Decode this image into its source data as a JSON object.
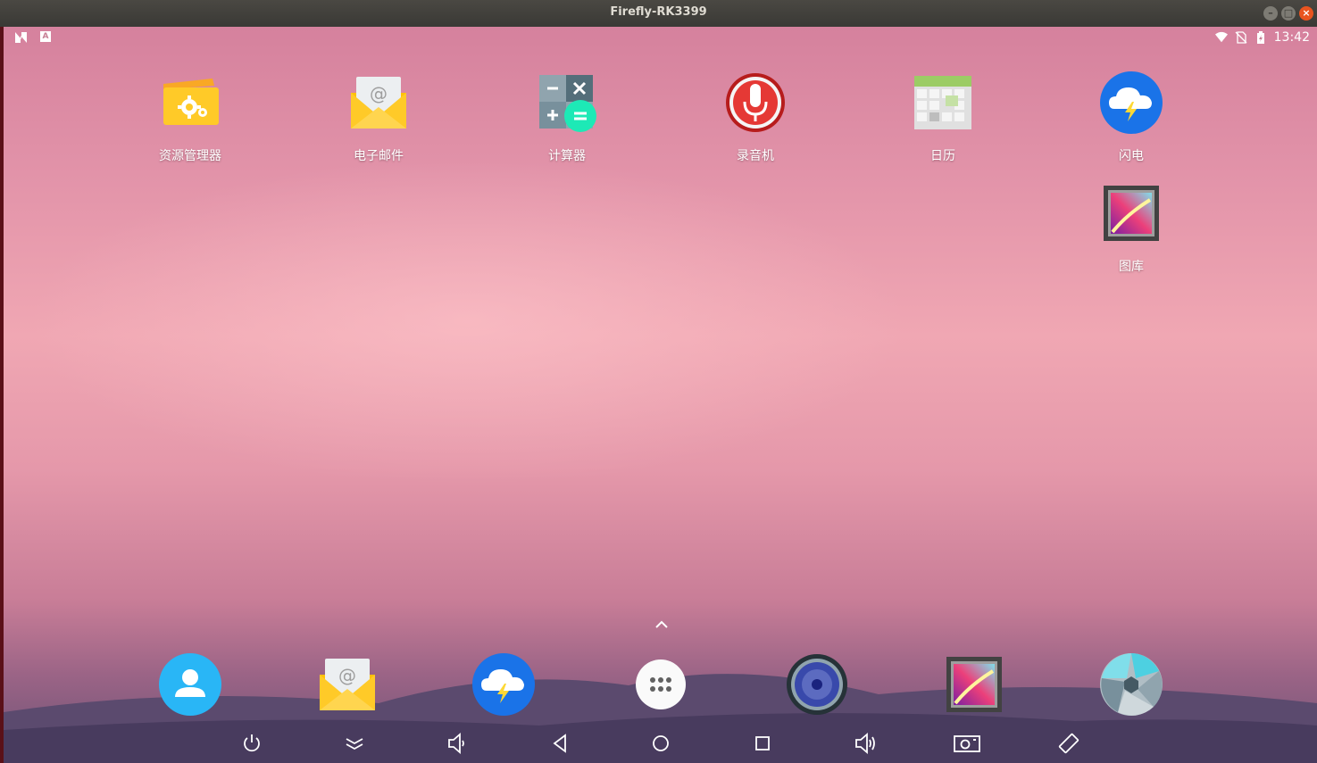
{
  "window": {
    "title": "Firefly-RK3399",
    "buttons": [
      "minimize",
      "maximize",
      "close"
    ]
  },
  "statusbar": {
    "time": "13:42",
    "left_icons": [
      "n-icon",
      "a-badge-icon"
    ],
    "right_icons": [
      "wifi-icon",
      "no-sim-icon",
      "battery-icon"
    ]
  },
  "apps": [
    {
      "label": "资源管理器",
      "icon": "file-manager-icon"
    },
    {
      "label": "电子邮件",
      "icon": "email-icon"
    },
    {
      "label": "计算器",
      "icon": "calculator-icon"
    },
    {
      "label": "录音机",
      "icon": "sound-recorder-icon"
    },
    {
      "label": "日历",
      "icon": "calendar-icon"
    },
    {
      "label": "闪电",
      "icon": "lightning-browser-icon"
    },
    {
      "label": "图库",
      "icon": "gallery-icon"
    }
  ],
  "dock": [
    "contacts-icon",
    "email-icon",
    "lightning-browser-icon",
    "app-drawer-icon",
    "music-icon",
    "gallery-icon",
    "camera-icon"
  ],
  "navbar": [
    "power-icon",
    "collapse-icon",
    "volume-down-icon",
    "back-icon",
    "home-icon",
    "recents-icon",
    "volume-up-icon",
    "screenshot-icon",
    "rotate-icon"
  ],
  "colors": {
    "wallpaper_top": "#d5819d",
    "wallpaper_mid": "#f0a7b3",
    "wallpaper_bottom": "#6d5175",
    "accent_blue": "#1a73e8"
  }
}
